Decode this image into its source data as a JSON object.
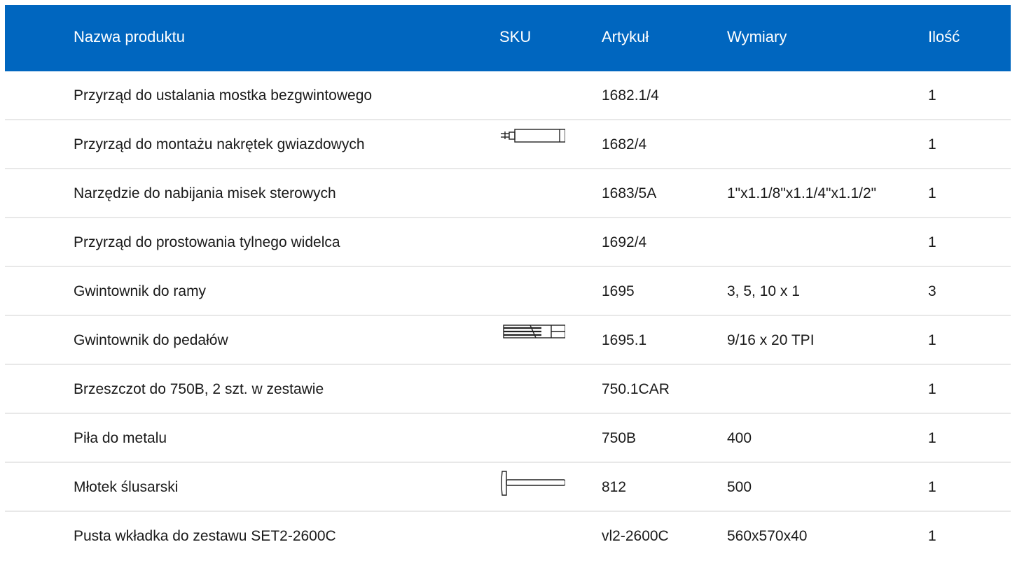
{
  "header": {
    "name": "Nazwa produktu",
    "sku": "SKU",
    "article": "Artykuł",
    "dimensions": "Wymiary",
    "quantity": "Ilość"
  },
  "rows": [
    {
      "name": "Przyrząd do ustalania mostka bezgwintowego",
      "icon": "",
      "article": "1682.1/4",
      "dimensions": "",
      "quantity": "1"
    },
    {
      "name": "Przyrząd do montażu nakrętek gwiazdowych",
      "icon": "star-nut-setter-icon",
      "article": "1682/4",
      "dimensions": "",
      "quantity": "1"
    },
    {
      "name": "Narzędzie do nabijania misek sterowych",
      "icon": "",
      "article": "1683/5A",
      "dimensions": "1\"x1.1/8\"x1.1/4\"x1.1/2\"",
      "quantity": "1"
    },
    {
      "name": "Przyrząd do prostowania tylnego widelca",
      "icon": "",
      "article": "1692/4",
      "dimensions": "",
      "quantity": "1"
    },
    {
      "name": "Gwintownik do ramy",
      "icon": "",
      "article": "1695",
      "dimensions": "3, 5, 10 x 1",
      "quantity": "3"
    },
    {
      "name": "Gwintownik do pedałów",
      "icon": "pedal-tap-icon",
      "article": "1695.1",
      "dimensions": "9/16 x 20 TPI",
      "quantity": "1"
    },
    {
      "name": "Brzeszczot do 750B, 2 szt. w zestawie",
      "icon": "",
      "article": "750.1CAR",
      "dimensions": "",
      "quantity": "1"
    },
    {
      "name": "Piła do metalu",
      "icon": "",
      "article": "750B",
      "dimensions": "400",
      "quantity": "1"
    },
    {
      "name": "Młotek ślusarski",
      "icon": "hammer-icon",
      "article": "812",
      "dimensions": "500",
      "quantity": "1"
    },
    {
      "name": "Pusta wkładka do zestawu SET2-2600C",
      "icon": "",
      "article": "vl2-2600C",
      "dimensions": "560x570x40",
      "quantity": "1"
    }
  ],
  "colors": {
    "header_bg": "#0066bf",
    "header_text": "#ffffff",
    "row_divider": "#e8e8e8"
  }
}
